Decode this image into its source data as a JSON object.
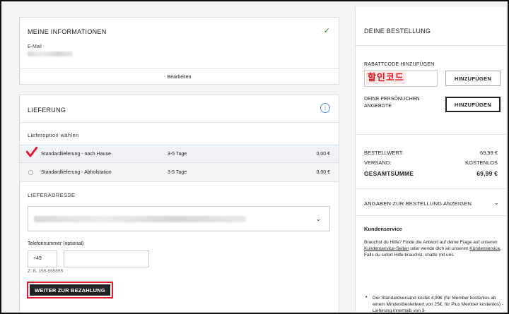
{
  "info": {
    "title": "MEINE INFORMATIONEN",
    "email_label": "E-Mail",
    "edit_label": "Bearbeiten"
  },
  "delivery": {
    "title": "LIEFERUNG",
    "option_heading": "Lieferoption wählen",
    "options": [
      {
        "name": "Standardlieferung - nach Hause",
        "days": "3-5 Tage",
        "price": "0,00 €",
        "selected": true
      },
      {
        "name": "Standardlieferung - Abholstation",
        "days": "3-5 Tage",
        "price": "0,00 €",
        "selected": false
      }
    ],
    "address_heading": "LIEFERADRESSE",
    "phone_label": "Telefonnummer (optional)",
    "phone_prefix": "+49",
    "phone_hint": "Z. B. 155-555555",
    "continue_label": "WEITER ZUR BEZAHLUNG"
  },
  "order": {
    "title": "DEINE BESTELLUNG",
    "discount_label": "RABATTCODE HINZUFÜGEN",
    "discount_value": "할인코드",
    "add_label": "HINZUFÜGEN",
    "offers_label": "DEINE PERSÖNLICHEN ANGEBOTE",
    "add_label_2": "HINZUFÜGEN",
    "subtotal_label": "BESTELLWERT:",
    "subtotal_value": "69,99 €",
    "shipping_label": "VERSAND:",
    "shipping_value": "KOSTENLOS",
    "total_label": "GESAMTSUMME",
    "total_value": "69,99 €",
    "details_label": "ANGABEN ZUR BESTELLUNG ANZEIGEN"
  },
  "service": {
    "title": "Kundenservice",
    "text_1": "Brauchst du Hilfe?  Finde die Antwort auf deine Frage auf unseren ",
    "link_1": "Kundenservice-Seiten",
    "text_2": " oder wende dich an  unseren ",
    "link_2": "Kundenservice",
    "text_3": ". Falls du sofort Hilfe brauchst, chatte mit uns.",
    "bullet": "Der Standardversand kostet 4,99€ (für Member kostenlos ab einem Mindestbestellwert von 25€, für Plus Member kostenlos) - Lieferung innerhalb von 3-"
  },
  "colors": {
    "accent_red": "#e21c2a",
    "check_green": "#2b8a3e",
    "info_blue": "#5b8dd6",
    "dark_button": "#222222"
  }
}
